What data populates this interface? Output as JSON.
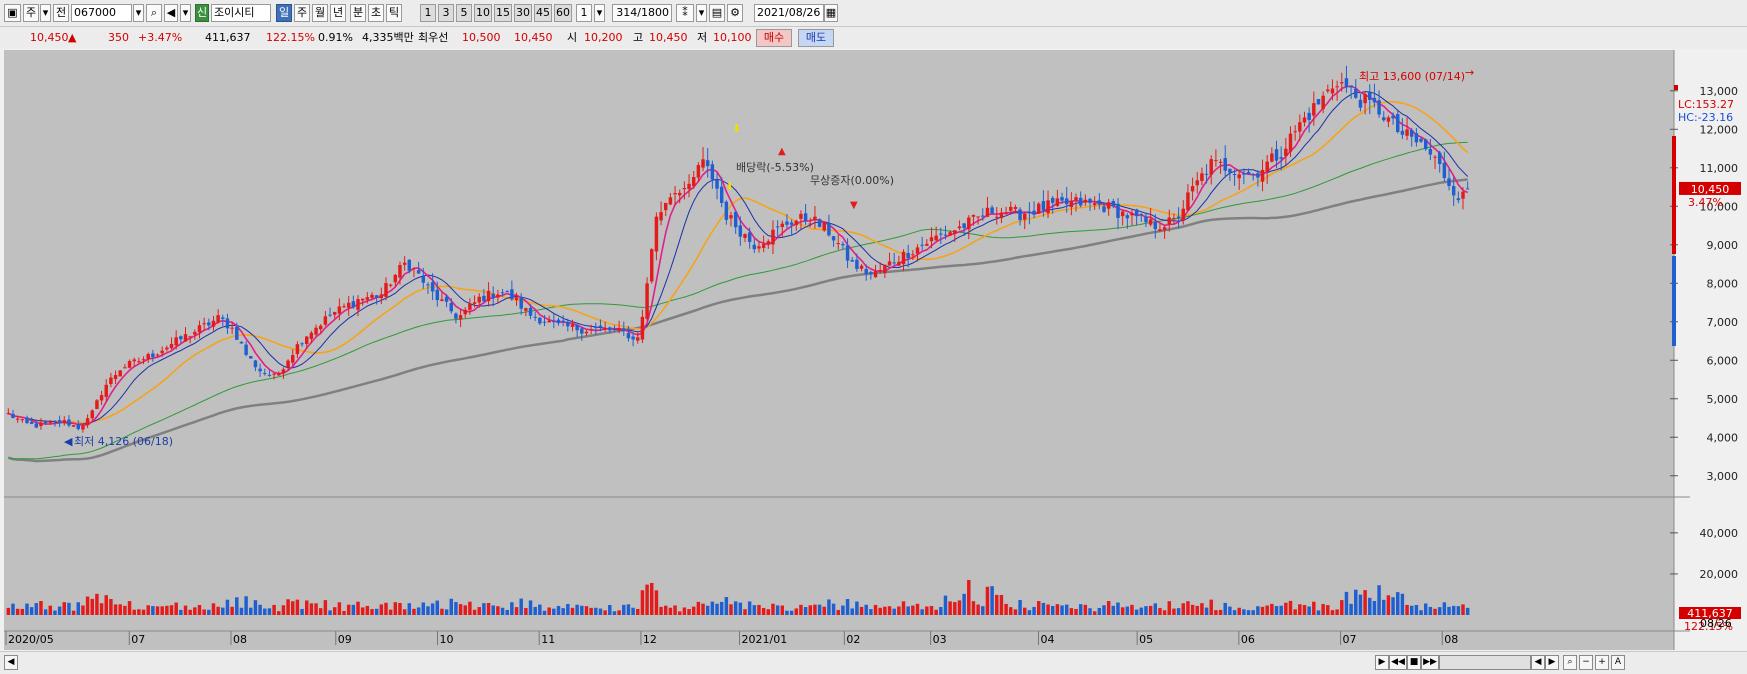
{
  "toolbar": {
    "market_label": "주",
    "prev_label": "전",
    "code": "067000",
    "new_badge": "신",
    "stock_name": "조이시티",
    "periods": [
      "일",
      "주",
      "월",
      "년",
      "분",
      "초",
      "틱"
    ],
    "active_period": "일",
    "minute_options": [
      "1",
      "3",
      "5",
      "10",
      "15",
      "30",
      "45",
      "60"
    ],
    "unit_value": "1",
    "count_shown": "314",
    "count_total": "/1800",
    "date": "2021/08/26"
  },
  "quote": {
    "price": "10,450",
    "change": "350",
    "change_pct": "+3.47%",
    "volume": "411,637",
    "volume_ratio": "122.15%",
    "turnover": "0.91%",
    "amount": "4,335백만",
    "best_ask_label": "최우선",
    "best_ask": "10,500",
    "best_bid": "10,450",
    "open_label": "시",
    "open": "10,200",
    "high_label": "고",
    "high": "10,450",
    "low_label": "저",
    "low": "10,100",
    "buy_label": "매수",
    "sell_label": "매도"
  },
  "chart_data": {
    "type": "candlestick",
    "x_tick_labels": [
      "2020/05",
      "07",
      "08",
      "09",
      "10",
      "11",
      "12",
      "2021/01",
      "02",
      "03",
      "04",
      "05",
      "06",
      "07",
      "08"
    ],
    "last_date_label": "08/26",
    "price_axis": {
      "min": 2500,
      "max": 13800,
      "ticks": [
        3000,
        4000,
        5000,
        6000,
        7000,
        8000,
        9000,
        10000,
        11000,
        12000,
        13000
      ]
    },
    "volume_axis": {
      "min": 0,
      "max": 56000,
      "ticks": [
        20000,
        40000
      ]
    },
    "current_price_label": "10,450",
    "current_change_label": "3.47%",
    "current_volume_label": "411,637",
    "current_volume_ratio_label": "122.15%",
    "lc_label": "LC:153.27",
    "hc_label": "HC:-23.16",
    "annotations": {
      "high": "최고 13,600 (07/14)",
      "low": "최저 4,126 (06/18)",
      "dividend": "배당락(-5.53%)",
      "bonus_issue": "무상증자(0.00%)"
    },
    "ma_colors": {
      "ma5": "#e0208a",
      "ma10": "#1c2fa8",
      "ma20": "#f5a31a",
      "ma60": "#2e9a3a",
      "ma120": "#808080"
    },
    "up_color": "#e31b1b",
    "down_color": "#1f5fd0",
    "keypoints": [
      [
        0,
        4600
      ],
      [
        12,
        4350
      ],
      [
        20,
        4300
      ],
      [
        40,
        4400
      ],
      [
        50,
        4250
      ],
      [
        58,
        4500
      ],
      [
        68,
        5300
      ],
      [
        80,
        5800
      ],
      [
        100,
        6100
      ],
      [
        115,
        6400
      ],
      [
        130,
        6700
      ],
      [
        150,
        7100
      ],
      [
        160,
        6800
      ],
      [
        170,
        6100
      ],
      [
        180,
        5700
      ],
      [
        190,
        5550
      ],
      [
        200,
        6100
      ],
      [
        210,
        6600
      ],
      [
        230,
        7200
      ],
      [
        250,
        7600
      ],
      [
        265,
        7700
      ],
      [
        275,
        8200
      ],
      [
        283,
        8550
      ],
      [
        290,
        8300
      ],
      [
        300,
        7800
      ],
      [
        320,
        7100
      ],
      [
        335,
        7600
      ],
      [
        350,
        7800
      ],
      [
        360,
        7600
      ],
      [
        370,
        7200
      ],
      [
        390,
        6900
      ],
      [
        410,
        6800
      ],
      [
        425,
        6800
      ],
      [
        440,
        6700
      ],
      [
        445,
        6500
      ],
      [
        450,
        6800
      ],
      [
        460,
        9600
      ],
      [
        470,
        10300
      ],
      [
        478,
        10500
      ],
      [
        485,
        10400
      ],
      [
        492,
        11200
      ],
      [
        502,
        10700
      ],
      [
        510,
        9800
      ],
      [
        520,
        9400
      ],
      [
        530,
        9000
      ],
      [
        540,
        9200
      ],
      [
        555,
        9600
      ],
      [
        570,
        9700
      ],
      [
        585,
        9300
      ],
      [
        600,
        8500
      ],
      [
        615,
        8200
      ],
      [
        630,
        8600
      ],
      [
        645,
        8900
      ],
      [
        660,
        9200
      ],
      [
        680,
        9500
      ],
      [
        700,
        9900
      ],
      [
        720,
        9800
      ],
      [
        740,
        10000
      ],
      [
        760,
        10100
      ],
      [
        780,
        10000
      ],
      [
        800,
        9700
      ],
      [
        815,
        9500
      ],
      [
        830,
        9600
      ],
      [
        840,
        10300
      ],
      [
        855,
        11100
      ],
      [
        870,
        11000
      ],
      [
        885,
        10800
      ],
      [
        905,
        11400
      ],
      [
        920,
        12200
      ],
      [
        935,
        12800
      ],
      [
        945,
        13300
      ],
      [
        960,
        12800
      ],
      [
        975,
        12500
      ],
      [
        990,
        11900
      ],
      [
        1005,
        11600
      ],
      [
        1015,
        11200
      ],
      [
        1025,
        10600
      ],
      [
        1033,
        10200
      ],
      [
        1038,
        10350
      ]
    ]
  }
}
